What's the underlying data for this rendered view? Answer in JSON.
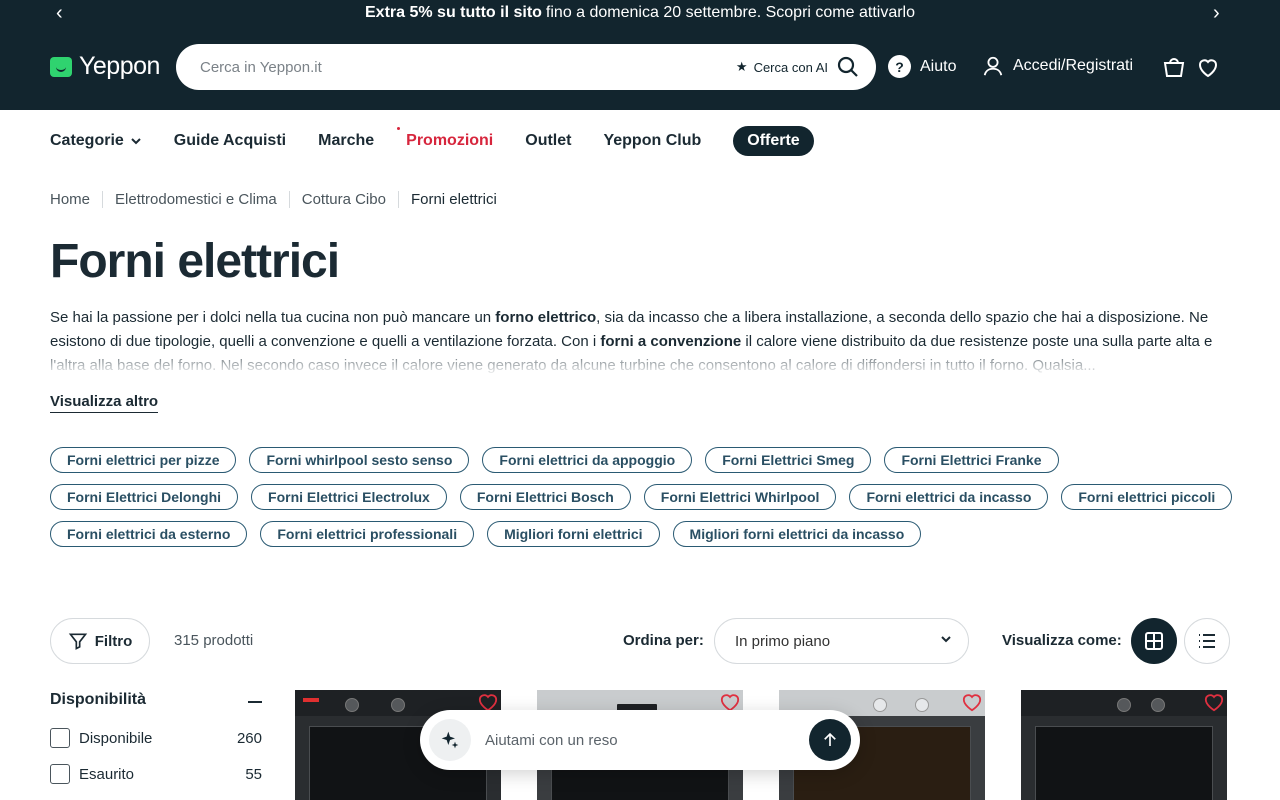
{
  "promo_bar": {
    "bold": "Extra 5% su tutto il sito",
    "text": "fino a domenica 20 settembre. Scopri come attivarlo",
    "prev": "‹",
    "next": "›"
  },
  "header": {
    "logo": "Yeppon",
    "search_placeholder": "Cerca in Yeppon.it",
    "ai_search": "Cerca con AI",
    "ai_star": "★",
    "help": "Aiuto",
    "help_symbol": "?",
    "login": "Accedi/Registrati"
  },
  "nav": {
    "categories": "Categorie",
    "chevron": "⌄",
    "guides": "Guide Acquisti",
    "brands": "Marche",
    "promotions": "Promozioni",
    "outlet": "Outlet",
    "club": "Yeppon Club",
    "offers": "Offerte"
  },
  "breadcrumb": [
    "Home",
    "Elettrodomestici e Clima",
    "Cottura Cibo",
    "Forni elettrici"
  ],
  "page": {
    "title": "Forni elettrici",
    "desc_1": "Se hai la passione per i dolci nella tua cucina non può mancare un ",
    "desc_b1": "forno elettrico",
    "desc_2": ", sia da incasso che a libera installazione, a seconda dello spazio che hai a disposizione. Ne esistono di due tipologie, quelli a convenzione e quelli a ventilazione forzata. Con i ",
    "desc_b2": "forni a convenzione",
    "desc_3": " il calore viene distribuito da due resistenze poste una sulla parte alta e l'altra alla base del forno. Nel secondo caso invece il calore viene generato da alcune turbine che consentono al calore di diffondersi in tutto il forno. Qualsia...",
    "more": "Visualizza altro"
  },
  "tags": [
    "Forni elettrici per pizze",
    "Forni whirlpool sesto senso",
    "Forni elettrici da appoggio",
    "Forni Elettrici Smeg",
    "Forni Elettrici Franke",
    "Forni Elettrici Delonghi",
    "Forni Elettrici Electrolux",
    "Forni Elettrici Bosch",
    "Forni Elettrici Whirlpool",
    "Forni elettrici da incasso",
    "Forni elettrici piccoli",
    "Forni elettrici da esterno",
    "Forni elettrici professionali",
    "Migliori forni elettrici",
    "Migliori forni elettrici da incasso"
  ],
  "toolbar": {
    "filter": "Filtro",
    "count": "315 prodotti",
    "sort_label": "Ordina per:",
    "sort_value": "In primo piano",
    "view_label": "Visualizza come:"
  },
  "facets": {
    "title": "Disponibilità",
    "items": [
      {
        "label": "Disponibile",
        "count": "260"
      },
      {
        "label": "Esaurito",
        "count": "55"
      }
    ]
  },
  "chat": {
    "placeholder": "Aiutami con un reso"
  },
  "colors": {
    "header_bg": "#12252e",
    "accent_green": "#2fd36f",
    "promo_red": "#d7263d"
  }
}
